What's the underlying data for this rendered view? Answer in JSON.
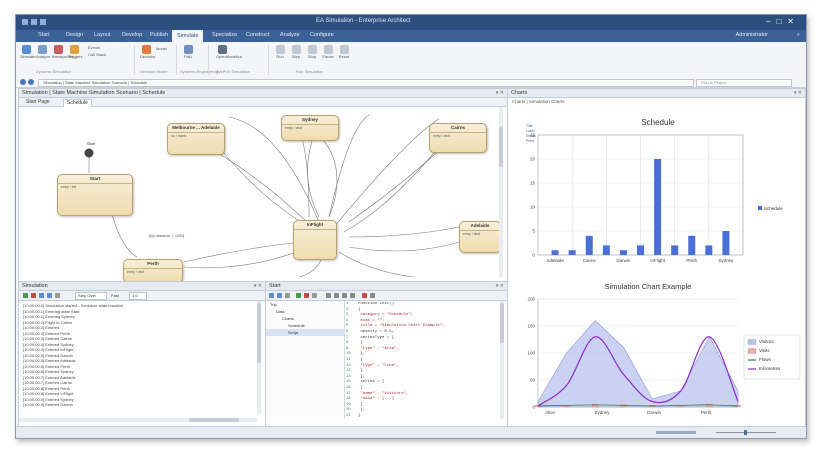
{
  "window": {
    "title": "EA Simulation - Enterprise Architect"
  },
  "menu": {
    "tabs": [
      "Start",
      "Design",
      "Layout",
      "Develop",
      "Publish",
      "Simulate",
      "Specialize",
      "Construct",
      "Analyze",
      "Configure"
    ],
    "active_tab": "Simulate",
    "user": "Administrator",
    "search": "Find Command..."
  },
  "ribbon": {
    "groups": [
      {
        "label": "Dynamic Simulation"
      },
      {
        "label": "Decision Model"
      },
      {
        "label": "Systems Engineering"
      },
      {
        "label": "SysPhS Simulation"
      },
      {
        "label": "Run Simulation"
      }
    ],
    "buttons": [
      "Simulate",
      "Analyze",
      "Breakpoints",
      "Triggers",
      "Events",
      "Call Stack",
      "Decision",
      "Model",
      "FMU",
      "OpenModelica",
      "Run",
      "Step",
      "Stop",
      "Pause",
      "Reset"
    ]
  },
  "address": {
    "path": "Simulation | State Machine Simulation Scenario | Schedule",
    "search_placeholder": "Find in Project"
  },
  "diagram": {
    "tabs": [
      "Start Page",
      "Schedule"
    ],
    "initial_label": "Start",
    "states": [
      {
        "name": "Start",
        "body": "entry / init"
      },
      {
        "name": "Sydney",
        "body": "entry / visit"
      },
      {
        "name": "Melbourne ... Adelaide",
        "body": "do / travel"
      },
      {
        "name": "Cairns",
        "body": "entry / visit"
      },
      {
        "name": "Adelaide",
        "body": "entry / visit"
      },
      {
        "name": "InFlight",
        "body": ""
      },
      {
        "name": "Perth",
        "body": "entry / visit"
      }
    ],
    "note": "[trip.distance > 1000]"
  },
  "simulation": {
    "title": "Simulation",
    "toolbar": [
      "Step Over",
      "Fast",
      "1.0"
    ],
    "lines": [
      "[10:00:00.0] Simulation started - Schedule state machine",
      "[10:00:00.1] Entering state Start",
      "[10:00:00.1] Entering Sydney",
      "[10:00:00.2] Flight to Cairns",
      "[10:00:00.2] Entered",
      "[10:00:00.3] Entered Perth",
      "[10:00:00.3] Entered Cairns",
      "[10:00:00.4] Entered Sydney",
      "[10:00:00.4] Entered InFlight",
      "[10:00:00.5] Entered Darwin",
      "[10:00:00.5] Entered Adelaide",
      "[10:00:00.6] Entered Perth",
      "[10:00:00.6] Entered Sydney",
      "[10:00:00.7] Entered Adelaide",
      "[10:00:00.7] Entered Cairns",
      "[10:00:00.8] Entered Perth",
      "[10:00:00.8] Entered InFlight",
      "[10:00:00.9] Entered Sydney",
      "[10:00:00.9] Entered Darwin"
    ]
  },
  "script": {
    "title": "Start",
    "tree": [
      "Trip",
      "Data",
      "Charts",
      "Schedule",
      "Script"
    ],
    "code": [
      "function Init()",
      "{",
      "  category = \"Schedule\";",
      "  ecat = \"\";",
      "  title = \"Simulation Chart Example\";",
      "  opacity = 0.5;",
      "  seriesType = [",
      "   {",
      "     \"type\" : \"Area\",",
      "   },",
      "   {",
      "     \"type\" : \"Line\",",
      "   }",
      "  ];",
      "  series = [",
      "   {",
      "     \"name\" : \"Visitors\",",
      "     \"data\" : [...]",
      "   }",
      "  ];",
      "}"
    ]
  },
  "charts": {
    "title": "Charts",
    "breadcrumb": "Charts | Simulation Charts",
    "legend_box": [
      "Title",
      "Label",
      "Series",
      "Point"
    ]
  },
  "chart_data": [
    {
      "type": "bar",
      "title": "Schedule",
      "categories": [
        "Adelaide",
        "Cairns",
        "Darwin",
        "InFlight",
        "Perth",
        "Sydney"
      ],
      "values": [
        1,
        1,
        4,
        2,
        1,
        2,
        20,
        2,
        4,
        2,
        5
      ],
      "x_positions": [
        0,
        0.5,
        1,
        1.5,
        2,
        2.5,
        3,
        3.5,
        4,
        4.5,
        5
      ],
      "series": [
        {
          "name": "Schedule"
        }
      ],
      "ylim": [
        0,
        25
      ],
      "yticks": [
        0,
        5,
        10,
        15,
        20,
        25
      ],
      "color": "#4a6fd6",
      "legend": "right"
    },
    {
      "type": "area",
      "title": "Simulation Chart Example",
      "categories": [
        "Alice",
        "Sydney",
        "Darwin",
        "Perth"
      ],
      "x": [
        0,
        0.5,
        1,
        1.5,
        2,
        2.5,
        3,
        3.5
      ],
      "ylim": [
        0,
        200
      ],
      "yticks": [
        0,
        50,
        100,
        150,
        200
      ],
      "legend": "right",
      "series": [
        {
          "name": "Visitors",
          "type": "area",
          "color": "#b8c2ee",
          "values": [
            10,
            100,
            160,
            110,
            15,
            30,
            130,
            30
          ]
        },
        {
          "name": "Visits",
          "type": "bar",
          "color": "#f0a9a9",
          "values": [
            3,
            3,
            5,
            4,
            3,
            3,
            5,
            3
          ]
        },
        {
          "name": "Flown",
          "type": "line",
          "color": "#3c7a3c",
          "values": [
            2,
            3,
            4,
            3,
            2,
            3,
            4,
            2
          ]
        },
        {
          "name": "Kilometres",
          "type": "line",
          "color": "#8a2bc8",
          "values": [
            2,
            40,
            130,
            60,
            10,
            30,
            130,
            10
          ]
        }
      ]
    }
  ]
}
